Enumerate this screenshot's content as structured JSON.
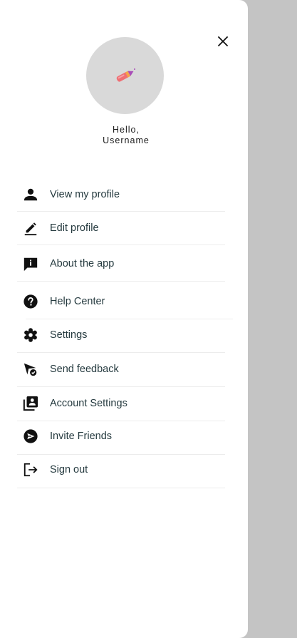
{
  "header": {
    "greeting_line1": "Hello,",
    "greeting_line2": "Username"
  },
  "colors": {
    "scrim": "#c4c4c4",
    "drawer": "#ffffff",
    "avatar_bg": "#d9d9d9",
    "icon": "#111111",
    "label": "#253a3f"
  },
  "menu": {
    "items": [
      {
        "label": "View my profile",
        "icon": "person-icon"
      },
      {
        "label": "Edit profile",
        "icon": "edit-icon"
      },
      {
        "label": "About the app",
        "icon": "info-message-icon"
      },
      {
        "label": "Help Center",
        "icon": "help-icon"
      },
      {
        "label": "Settings",
        "icon": "settings-icon"
      },
      {
        "label": "Send feedback",
        "icon": "send-feedback-icon"
      },
      {
        "label": "Account Settings",
        "icon": "contacts-icon"
      },
      {
        "label": "Invite Friends",
        "icon": "send-circle-icon"
      },
      {
        "label": "Sign out",
        "icon": "logout-icon"
      }
    ]
  }
}
